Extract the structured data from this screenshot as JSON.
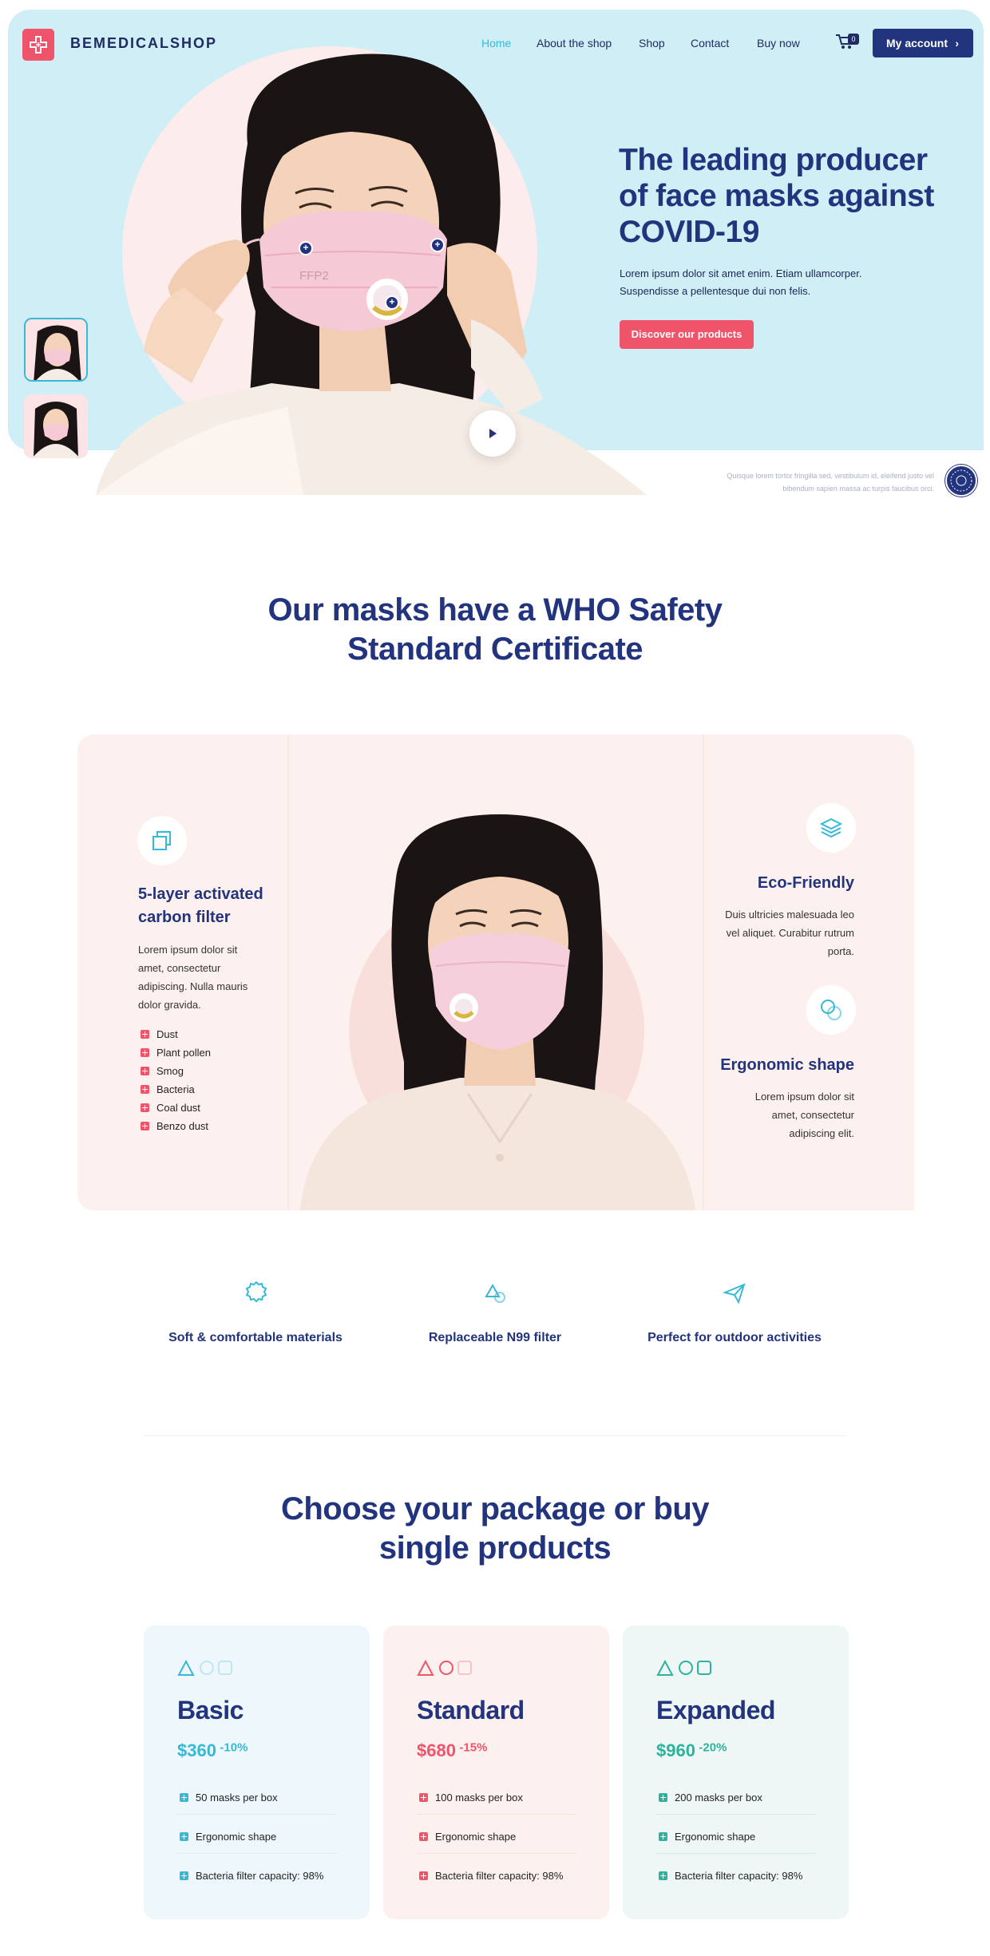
{
  "colors": {
    "brand_navy": "#23347e",
    "accent_cyan": "#35b9d7",
    "accent_pink": "#f0546a",
    "hero_bg": "#cfeef6",
    "panel_bg": "#fdf1ef"
  },
  "header": {
    "brand": "BEMEDICALSHOP",
    "nav": [
      "Home",
      "About the shop",
      "Shop",
      "Contact",
      "Buy now"
    ],
    "cart_count": "0",
    "account_button": "My account"
  },
  "hero": {
    "title": "The leading producer of face masks against COVID-19",
    "text": "Lorem ipsum dolor sit amet enim. Etiam ullamcorper. Suspendisse a pellentesque dui non felis.",
    "cta": "Discover our products",
    "fine_print": "Quisque lorem tortor fringilla sed, vestibulum id, eleifend justo vel bibendum sapien massa ac turpis faucibus orci.",
    "mask_text": "FFP2"
  },
  "certificate": {
    "title": "Our masks have a WHO Safety Standard Certificate"
  },
  "features": {
    "left": {
      "title": "5-layer activated carbon filter",
      "text": "Lorem ipsum dolor sit amet, consectetur adipiscing. Nulla mauris dolor gravida.",
      "bullets": [
        "Dust",
        "Plant pollen",
        "Smog",
        "Bacteria",
        "Coal dust",
        "Benzo dust"
      ]
    },
    "right": [
      {
        "title": "Eco-Friendly",
        "text": "Duis ultricies malesuada leo vel aliquet. Curabitur rutrum porta."
      },
      {
        "title": "Ergonomic shape",
        "text": "Lorem ipsum dolor sit amet, consectetur adipiscing elit."
      }
    ]
  },
  "benefits": [
    {
      "label": "Soft & comfortable materials",
      "icon": "badge-icon"
    },
    {
      "label": "Replaceable N99 filter",
      "icon": "shapes-icon"
    },
    {
      "label": "Perfect for outdoor activities",
      "icon": "paper-plane-icon"
    }
  ],
  "pricing": {
    "title": "Choose your package or buy single products",
    "plans": [
      {
        "name": "Basic",
        "price": "$360",
        "discount": "-10%",
        "items": [
          "50 masks per box",
          "Ergonomic shape",
          "Bacteria filter capacity: 98%"
        ],
        "color": "#35b9d7",
        "bg": "#eef8fc"
      },
      {
        "name": "Standard",
        "price": "$680",
        "discount": "-15%",
        "items": [
          "100 masks per box",
          "Ergonomic shape",
          "Bacteria filter capacity: 98%"
        ],
        "color": "#f0546a",
        "bg": "#fdf1ef"
      },
      {
        "name": "Expanded",
        "price": "$960",
        "discount": "-20%",
        "items": [
          "200 masks per box",
          "Ergonomic shape",
          "Bacteria filter capacity: 98%"
        ],
        "color": "#2bb39b",
        "bg": "#eef7f5"
      }
    ]
  }
}
